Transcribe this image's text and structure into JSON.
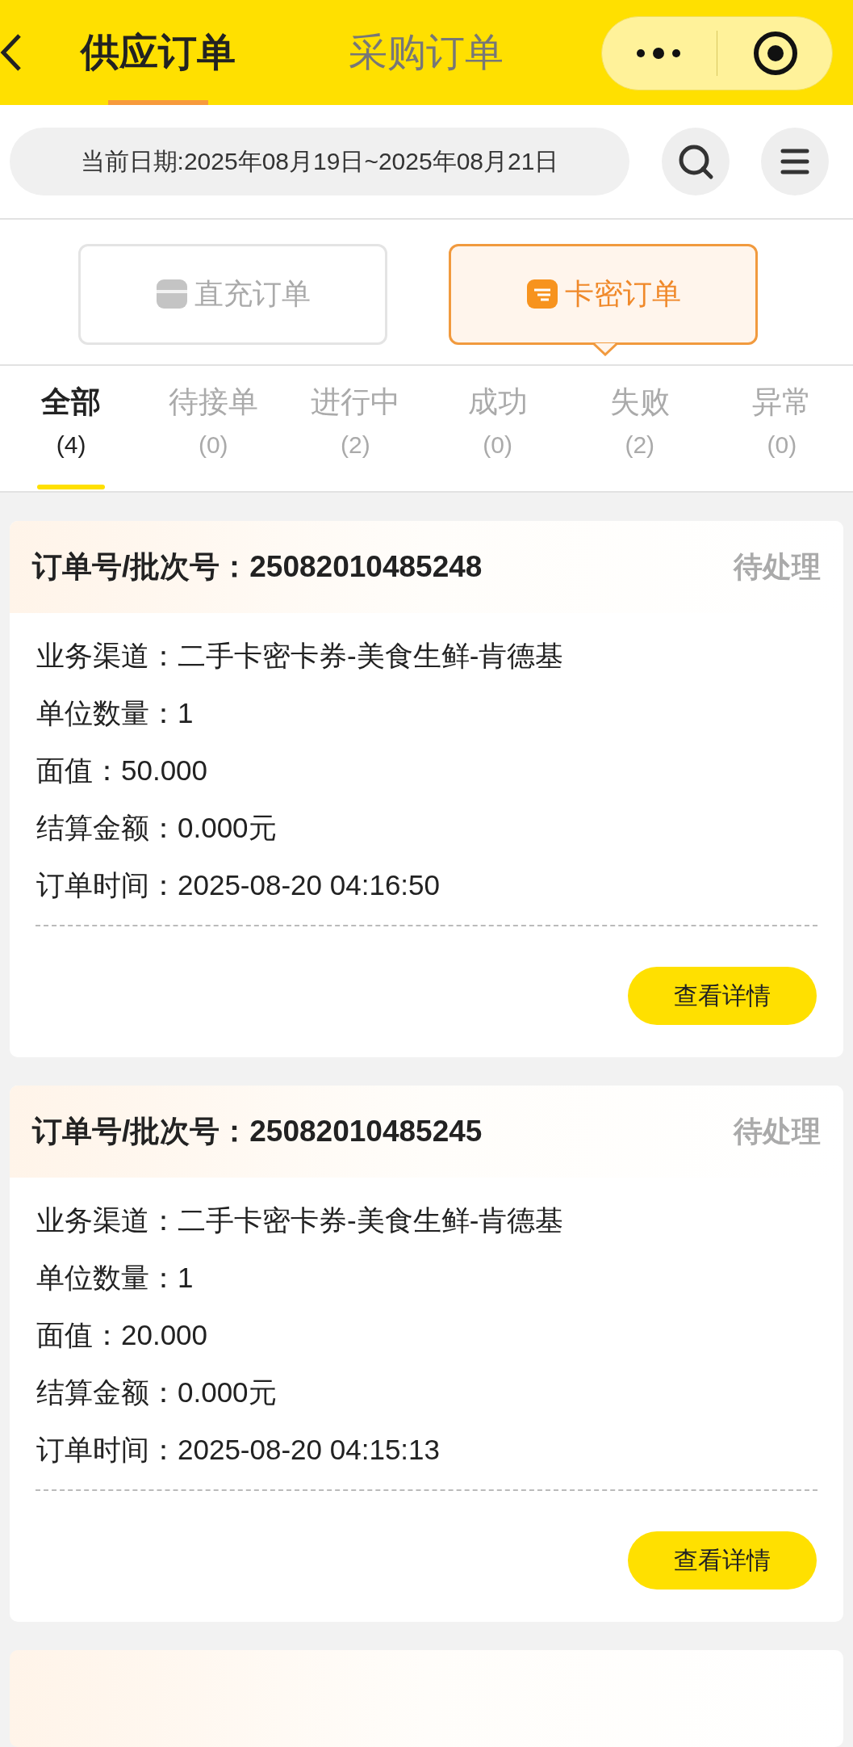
{
  "header": {
    "tabs": [
      {
        "label": "供应订单",
        "selected": true
      },
      {
        "label": "采购订单",
        "selected": false
      }
    ]
  },
  "date_bar": {
    "text": "当前日期:2025年08月19日~2025年08月21日"
  },
  "order_types": [
    {
      "label": "直充订单",
      "selected": false
    },
    {
      "label": "卡密订单",
      "selected": true
    }
  ],
  "status_tabs": [
    {
      "label": "全部",
      "count": "(4)",
      "selected": true
    },
    {
      "label": "待接单",
      "count": "(0)",
      "selected": false
    },
    {
      "label": "进行中",
      "count": "(2)",
      "selected": false
    },
    {
      "label": "成功",
      "count": "(0)",
      "selected": false
    },
    {
      "label": "失败",
      "count": "(2)",
      "selected": false
    },
    {
      "label": "异常",
      "count": "(0)",
      "selected": false
    }
  ],
  "orders": [
    {
      "order_no": "订单号/批次号：25082010485248",
      "status": "待处理",
      "fields": [
        "业务渠道：二手卡密卡券-美食生鲜-肯德基",
        "单位数量：1",
        "面值：50.000",
        "结算金额：0.000元",
        "订单时间：2025-08-20 04:16:50"
      ],
      "button": "查看详情"
    },
    {
      "order_no": "订单号/批次号：25082010485245",
      "status": "待处理",
      "fields": [
        "业务渠道：二手卡密卡券-美食生鲜-肯德基",
        "单位数量：1",
        "面值：20.000",
        "结算金额：0.000元",
        "订单时间：2025-08-20 04:15:13"
      ],
      "button": "查看详情"
    }
  ]
}
